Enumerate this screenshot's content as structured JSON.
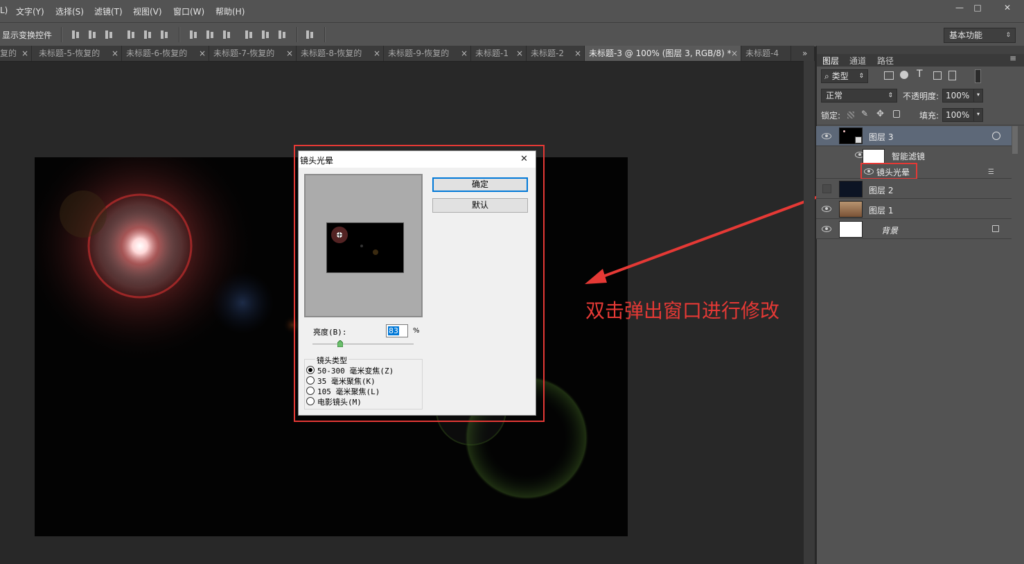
{
  "menu": [
    "L)",
    "文字(Y)",
    "选择(S)",
    "滤镜(T)",
    "视图(V)",
    "窗口(W)",
    "帮助(H)"
  ],
  "window_controls": [
    "—",
    "□",
    "✕"
  ],
  "options": {
    "show_transform": "显示变换控件",
    "workspace": "基本功能"
  },
  "tabs": [
    {
      "label": "复的",
      "active": false
    },
    {
      "label": "未标题-5-恢复的",
      "active": false
    },
    {
      "label": "未标题-6-恢复的",
      "active": false
    },
    {
      "label": "未标题-7-恢复的",
      "active": false
    },
    {
      "label": "未标题-8-恢复的",
      "active": false
    },
    {
      "label": "未标题-9-恢复的",
      "active": false
    },
    {
      "label": "未标题-1",
      "active": false
    },
    {
      "label": "未标题-2",
      "active": false
    },
    {
      "label": "未标题-3 @ 100% (图层 3, RGB/8) *",
      "active": true
    },
    {
      "label": "未标题-4",
      "active": false
    }
  ],
  "tab_close": "×",
  "tab_overflow": "»",
  "panel": {
    "tabs": [
      "图层",
      "通道",
      "路径"
    ],
    "menu_icon": "≡",
    "filter_kind": "类型",
    "blend_mode": "正常",
    "opacity_label": "不透明度:",
    "opacity_value": "100%",
    "lock_label": "锁定:",
    "fill_label": "填充:",
    "fill_value": "100%",
    "layers": {
      "layer3": "图层 3",
      "smart_filters": "智能滤镜",
      "lens_flare": "镜头光晕",
      "layer2": "图层 2",
      "layer1": "图层 1",
      "background": "背景"
    }
  },
  "dialog": {
    "title": "镜头光晕",
    "close": "✕",
    "ok": "确定",
    "default": "默认",
    "brightness_label": "亮度(B):",
    "brightness_value": "83",
    "percent": "%",
    "brightness_level_percent": 83,
    "group_title": "镜头类型",
    "options": [
      "50-300 毫米变焦(Z)",
      "35 毫米聚焦(K)",
      "105 毫米聚焦(L)",
      "电影镜头(M)"
    ],
    "selected_option": 0
  },
  "annotation": {
    "text": "双击弹出窗口进行修改",
    "color": "#e53935"
  },
  "colors": {
    "highlight": "#e53935",
    "selected_layer": "#5d6878"
  }
}
